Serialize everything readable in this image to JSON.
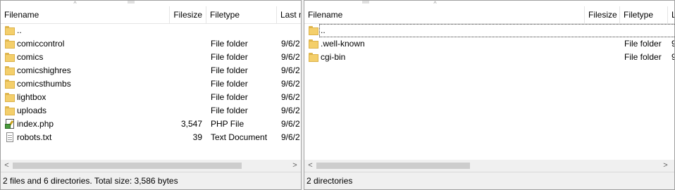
{
  "local": {
    "columns": {
      "filename": "Filename",
      "filesize": "Filesize",
      "filetype": "Filetype",
      "last_modified": "Last modified"
    },
    "rows": [
      {
        "name": "..",
        "size": "",
        "type": "",
        "modified": "",
        "icon": "folder-icon"
      },
      {
        "name": "comiccontrol",
        "size": "",
        "type": "File folder",
        "modified": "9/6/2",
        "icon": "folder-icon"
      },
      {
        "name": "comics",
        "size": "",
        "type": "File folder",
        "modified": "9/6/2",
        "icon": "folder-icon"
      },
      {
        "name": "comicshighres",
        "size": "",
        "type": "File folder",
        "modified": "9/6/2",
        "icon": "folder-icon"
      },
      {
        "name": "comicsthumbs",
        "size": "",
        "type": "File folder",
        "modified": "9/6/2",
        "icon": "folder-icon"
      },
      {
        "name": "lightbox",
        "size": "",
        "type": "File folder",
        "modified": "9/6/2",
        "icon": "folder-icon"
      },
      {
        "name": "uploads",
        "size": "",
        "type": "File folder",
        "modified": "9/6/2",
        "icon": "folder-icon"
      },
      {
        "name": "index.php",
        "size": "3,547",
        "type": "PHP File",
        "modified": "9/6/2",
        "icon": "php-file-icon"
      },
      {
        "name": "robots.txt",
        "size": "39",
        "type": "Text Document",
        "modified": "9/6/2",
        "icon": "text-file-icon"
      }
    ],
    "status": "2 files and 6 directories. Total size: 3,586 bytes"
  },
  "remote": {
    "columns": {
      "filename": "Filename",
      "filesize": "Filesize",
      "filetype": "Filetype",
      "last_modified": "Last modified"
    },
    "rows": [
      {
        "name": "..",
        "size": "",
        "type": "",
        "modified": "",
        "icon": "folder-icon"
      },
      {
        "name": ".well-known",
        "size": "",
        "type": "File folder",
        "modified": "9",
        "icon": "folder-icon"
      },
      {
        "name": "cgi-bin",
        "size": "",
        "type": "File folder",
        "modified": "9",
        "icon": "folder-icon"
      }
    ],
    "status": "2 directories"
  },
  "icons": {
    "sort_caret": "^",
    "scroll_left": "<",
    "scroll_right": ">"
  },
  "colors": {
    "folder": "#f4cf6b",
    "header_divider": "#e5e5e5",
    "scroll_thumb": "#cdcdcd"
  }
}
